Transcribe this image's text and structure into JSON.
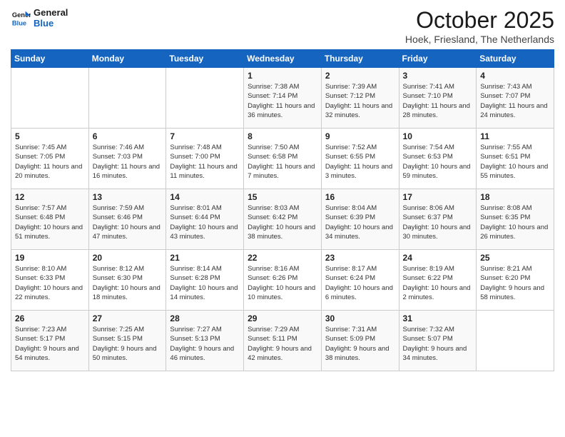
{
  "header": {
    "logo_general": "General",
    "logo_blue": "Blue",
    "month_title": "October 2025",
    "location": "Hoek, Friesland, The Netherlands"
  },
  "days_of_week": [
    "Sunday",
    "Monday",
    "Tuesday",
    "Wednesday",
    "Thursday",
    "Friday",
    "Saturday"
  ],
  "weeks": [
    [
      {
        "day": "",
        "info": ""
      },
      {
        "day": "",
        "info": ""
      },
      {
        "day": "",
        "info": ""
      },
      {
        "day": "1",
        "info": "Sunrise: 7:38 AM\nSunset: 7:14 PM\nDaylight: 11 hours\nand 36 minutes."
      },
      {
        "day": "2",
        "info": "Sunrise: 7:39 AM\nSunset: 7:12 PM\nDaylight: 11 hours\nand 32 minutes."
      },
      {
        "day": "3",
        "info": "Sunrise: 7:41 AM\nSunset: 7:10 PM\nDaylight: 11 hours\nand 28 minutes."
      },
      {
        "day": "4",
        "info": "Sunrise: 7:43 AM\nSunset: 7:07 PM\nDaylight: 11 hours\nand 24 minutes."
      }
    ],
    [
      {
        "day": "5",
        "info": "Sunrise: 7:45 AM\nSunset: 7:05 PM\nDaylight: 11 hours\nand 20 minutes."
      },
      {
        "day": "6",
        "info": "Sunrise: 7:46 AM\nSunset: 7:03 PM\nDaylight: 11 hours\nand 16 minutes."
      },
      {
        "day": "7",
        "info": "Sunrise: 7:48 AM\nSunset: 7:00 PM\nDaylight: 11 hours\nand 11 minutes."
      },
      {
        "day": "8",
        "info": "Sunrise: 7:50 AM\nSunset: 6:58 PM\nDaylight: 11 hours\nand 7 minutes."
      },
      {
        "day": "9",
        "info": "Sunrise: 7:52 AM\nSunset: 6:55 PM\nDaylight: 11 hours\nand 3 minutes."
      },
      {
        "day": "10",
        "info": "Sunrise: 7:54 AM\nSunset: 6:53 PM\nDaylight: 10 hours\nand 59 minutes."
      },
      {
        "day": "11",
        "info": "Sunrise: 7:55 AM\nSunset: 6:51 PM\nDaylight: 10 hours\nand 55 minutes."
      }
    ],
    [
      {
        "day": "12",
        "info": "Sunrise: 7:57 AM\nSunset: 6:48 PM\nDaylight: 10 hours\nand 51 minutes."
      },
      {
        "day": "13",
        "info": "Sunrise: 7:59 AM\nSunset: 6:46 PM\nDaylight: 10 hours\nand 47 minutes."
      },
      {
        "day": "14",
        "info": "Sunrise: 8:01 AM\nSunset: 6:44 PM\nDaylight: 10 hours\nand 43 minutes."
      },
      {
        "day": "15",
        "info": "Sunrise: 8:03 AM\nSunset: 6:42 PM\nDaylight: 10 hours\nand 38 minutes."
      },
      {
        "day": "16",
        "info": "Sunrise: 8:04 AM\nSunset: 6:39 PM\nDaylight: 10 hours\nand 34 minutes."
      },
      {
        "day": "17",
        "info": "Sunrise: 8:06 AM\nSunset: 6:37 PM\nDaylight: 10 hours\nand 30 minutes."
      },
      {
        "day": "18",
        "info": "Sunrise: 8:08 AM\nSunset: 6:35 PM\nDaylight: 10 hours\nand 26 minutes."
      }
    ],
    [
      {
        "day": "19",
        "info": "Sunrise: 8:10 AM\nSunset: 6:33 PM\nDaylight: 10 hours\nand 22 minutes."
      },
      {
        "day": "20",
        "info": "Sunrise: 8:12 AM\nSunset: 6:30 PM\nDaylight: 10 hours\nand 18 minutes."
      },
      {
        "day": "21",
        "info": "Sunrise: 8:14 AM\nSunset: 6:28 PM\nDaylight: 10 hours\nand 14 minutes."
      },
      {
        "day": "22",
        "info": "Sunrise: 8:16 AM\nSunset: 6:26 PM\nDaylight: 10 hours\nand 10 minutes."
      },
      {
        "day": "23",
        "info": "Sunrise: 8:17 AM\nSunset: 6:24 PM\nDaylight: 10 hours\nand 6 minutes."
      },
      {
        "day": "24",
        "info": "Sunrise: 8:19 AM\nSunset: 6:22 PM\nDaylight: 10 hours\nand 2 minutes."
      },
      {
        "day": "25",
        "info": "Sunrise: 8:21 AM\nSunset: 6:20 PM\nDaylight: 9 hours\nand 58 minutes."
      }
    ],
    [
      {
        "day": "26",
        "info": "Sunrise: 7:23 AM\nSunset: 5:17 PM\nDaylight: 9 hours\nand 54 minutes."
      },
      {
        "day": "27",
        "info": "Sunrise: 7:25 AM\nSunset: 5:15 PM\nDaylight: 9 hours\nand 50 minutes."
      },
      {
        "day": "28",
        "info": "Sunrise: 7:27 AM\nSunset: 5:13 PM\nDaylight: 9 hours\nand 46 minutes."
      },
      {
        "day": "29",
        "info": "Sunrise: 7:29 AM\nSunset: 5:11 PM\nDaylight: 9 hours\nand 42 minutes."
      },
      {
        "day": "30",
        "info": "Sunrise: 7:31 AM\nSunset: 5:09 PM\nDaylight: 9 hours\nand 38 minutes."
      },
      {
        "day": "31",
        "info": "Sunrise: 7:32 AM\nSunset: 5:07 PM\nDaylight: 9 hours\nand 34 minutes."
      },
      {
        "day": "",
        "info": ""
      }
    ]
  ]
}
